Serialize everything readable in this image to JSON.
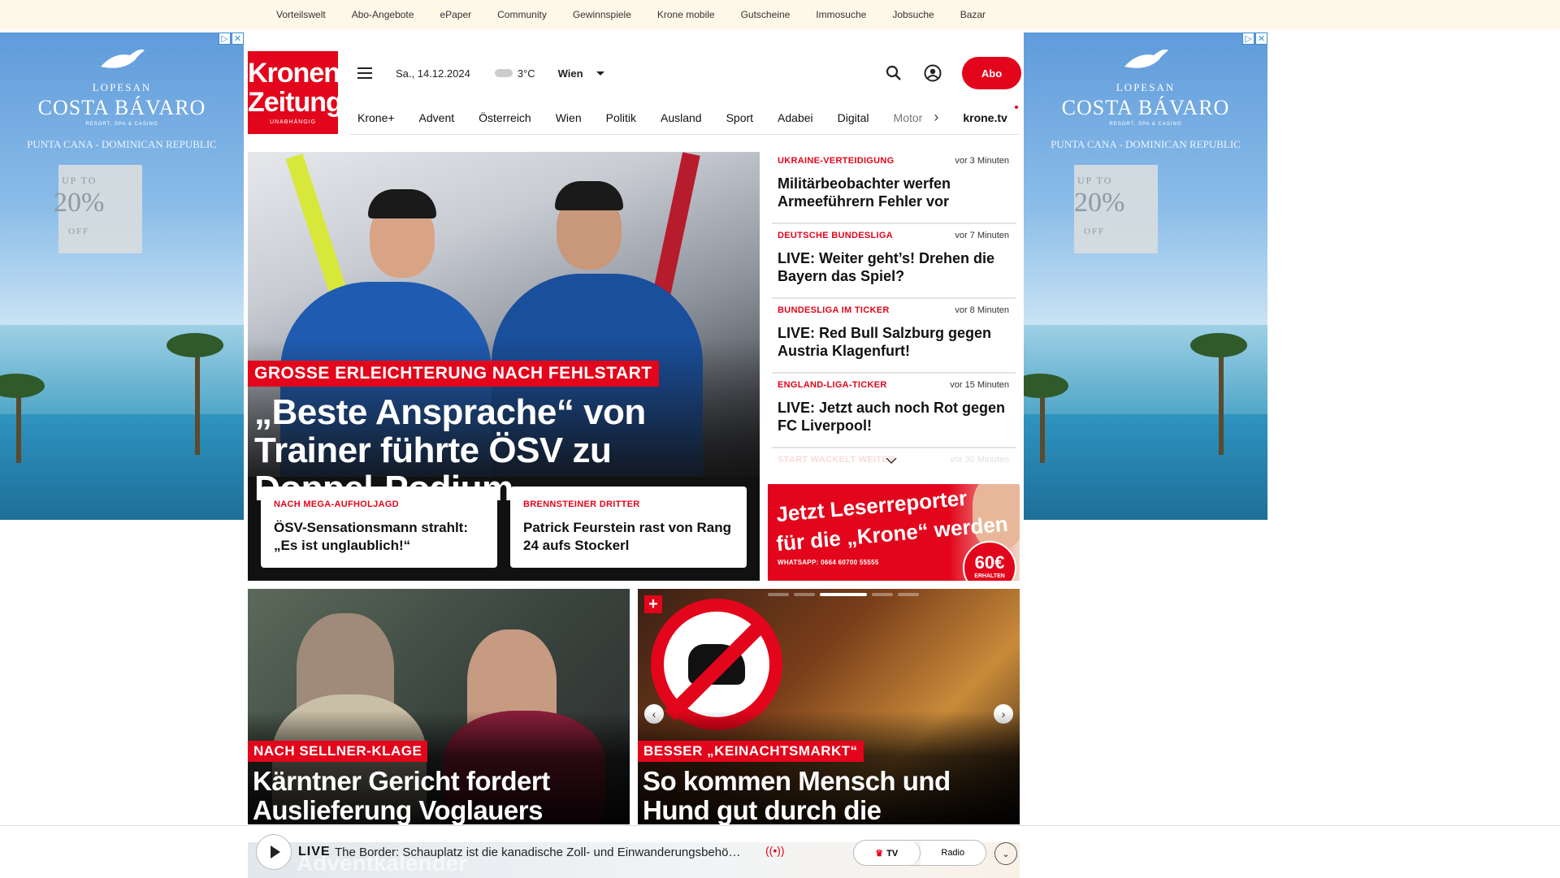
{
  "topbar": {
    "links": [
      "Vorteilswelt",
      "Abo-Angebote",
      "ePaper",
      "Community",
      "Gewinnspiele",
      "Krone mobile",
      "Gutscheine",
      "Immosuche",
      "Jobsuche",
      "Bazar"
    ]
  },
  "ad": {
    "brand_top": "LOPESAN",
    "brand": "COSTA BÁVARO",
    "brand_sub": "RESORT, SPA & CASINO",
    "region": "PUNTA CANA - DOMINICAN REPUBLIC",
    "promo_upto": "UP TO",
    "promo_left_pct": "20%",
    "promo_right_pct": "20%",
    "promo_off": "OFF"
  },
  "header": {
    "logo_line1": "Kronen",
    "logo_line2": "Zeitung",
    "logo_line3": "UNABHÄNGIG",
    "date": "Sa., 14.12.2024",
    "temperature": "3°C",
    "city": "Wien",
    "abo_label": "Abo",
    "icons": [
      "menu-icon",
      "cloud-icon",
      "search-icon",
      "account-icon"
    ]
  },
  "nav": {
    "items": [
      "Krone+",
      "Advent",
      "Österreich",
      "Wien",
      "Politik",
      "Ausland",
      "Sport",
      "Adabei",
      "Digital",
      "Motor"
    ],
    "tv": "krone.tv"
  },
  "hero": {
    "kicker": "GROSSE ERLEICHTERUNG NACH FEHLSTART",
    "title": "„Beste Ansprache“ von Trainer führte ÖSV zu Doppel-Podium",
    "sub": [
      {
        "kicker": "NACH MEGA-AUFHOLJAGD",
        "title": "ÖSV-Sensationsmann strahlt: „Es ist unglaublich!“"
      },
      {
        "kicker": "BRENNSTEINER DRITTER",
        "title": "Patrick Feurstein rast von Rang 24 aufs Stockerl"
      }
    ]
  },
  "news": [
    {
      "category": "UKRAINE-VERTEIDIGUNG",
      "time": "vor 3 Minuten",
      "headline": "Militärbeobachter werfen Armeeführern Fehler vor"
    },
    {
      "category": "DEUTSCHE BUNDESLIGA",
      "time": "vor 7 Minuten",
      "headline": "LIVE: Weiter geht’s! Drehen die Bayern das Spiel?"
    },
    {
      "category": "BUNDESLIGA IM TICKER",
      "time": "vor 8 Minuten",
      "headline": "LIVE: Red Bull Salzburg gegen Austria Klagenfurt!"
    },
    {
      "category": "ENGLAND-LIGA-TICKER",
      "time": "vor 15 Minuten",
      "headline": "LIVE: Jetzt auch noch Rot gegen FC Liverpool!"
    },
    {
      "category": "START WACKELT WEITER",
      "time": "vor 30 Minuten",
      "headline": ""
    }
  ],
  "leser": {
    "line1": "Jetzt Leserreporter",
    "line2": "für die „Krone“ werden",
    "whatsapp": "WHATSAPP: 0664 60700 55555",
    "amount": "60€",
    "amount_sub": "ERHALTEN"
  },
  "cards": [
    {
      "kicker": "NACH SELLNER-KLAGE",
      "title": "Kärntner Gericht fordert Auslieferung Voglauers"
    },
    {
      "kicker": "BESSER „KEINACHTSMARKT“",
      "title": "So kommen Mensch und Hund gut durch die Adventzeit"
    }
  ],
  "player": {
    "live_label": "LIVE",
    "text": "The Border: Schauplatz ist die kanadische Zoll- und Einwanderungsbehö…",
    "tv": "TV",
    "radio": "Radio",
    "underlay": "Adventkalender"
  }
}
